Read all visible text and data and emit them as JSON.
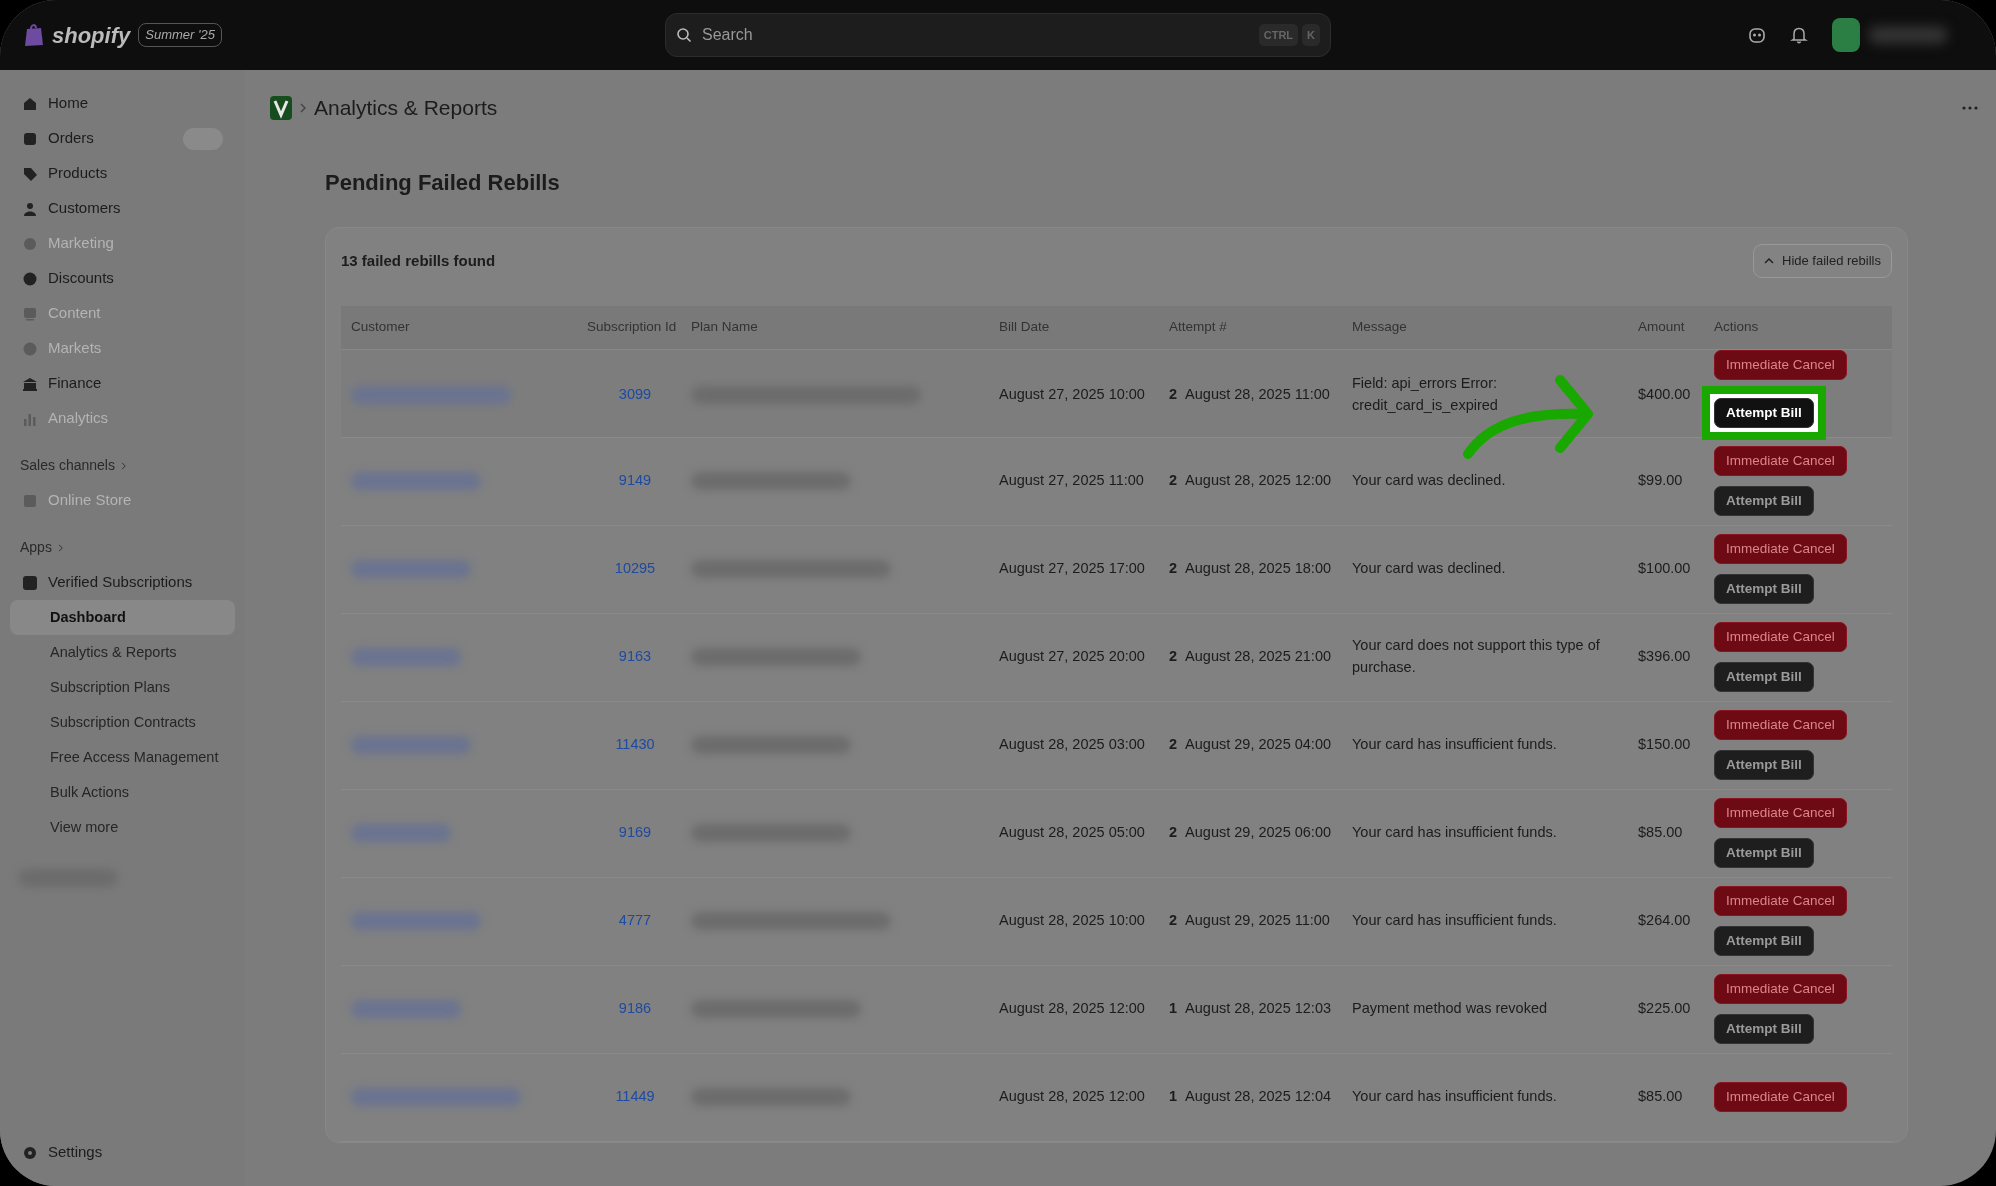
{
  "topbar": {
    "logo": "shopify",
    "edition": "Summer '25",
    "search": {
      "placeholder": "Search"
    },
    "shortcut": [
      "CTRL",
      "K"
    ]
  },
  "sidebar": {
    "items": [
      {
        "label": "Home",
        "disabled": false
      },
      {
        "label": "Orders",
        "disabled": false
      },
      {
        "label": "Products",
        "disabled": false
      },
      {
        "label": "Customers",
        "disabled": false
      },
      {
        "label": "Marketing",
        "disabled": true
      },
      {
        "label": "Discounts",
        "disabled": false
      },
      {
        "label": "Content",
        "disabled": true
      },
      {
        "label": "Markets",
        "disabled": true
      },
      {
        "label": "Finance",
        "disabled": false
      },
      {
        "label": "Analytics",
        "disabled": true
      }
    ],
    "sales_channels": {
      "heading": "Sales channels",
      "items": [
        {
          "label": "Online Store",
          "disabled": true
        }
      ]
    },
    "apps": {
      "heading": "Apps",
      "app": "Verified Subscriptions",
      "items": [
        {
          "label": "Dashboard",
          "selected": true
        },
        {
          "label": "Analytics & Reports",
          "selected": false
        },
        {
          "label": "Subscription Plans",
          "selected": false
        },
        {
          "label": "Subscription Contracts",
          "selected": false
        },
        {
          "label": "Free Access Management",
          "selected": false
        },
        {
          "label": "Bulk Actions",
          "selected": false
        },
        {
          "label": "View more",
          "selected": false
        }
      ]
    },
    "settings": "Settings"
  },
  "breadcrumb": {
    "title": "Analytics & Reports"
  },
  "page": {
    "title": "Pending Failed Rebills",
    "summary": "13 failed rebills found",
    "toggle": "Hide failed rebills"
  },
  "table": {
    "columns": [
      "Customer",
      "Subscription Id",
      "Plan Name",
      "Bill Date",
      "Attempt #",
      "Message",
      "Amount",
      "Actions"
    ],
    "rows": [
      {
        "subscription_id": "3099",
        "bill_date": "August 27, 2025 10:00",
        "attempt": "2",
        "attempt_date": "August 28, 2025 11:00",
        "message": "Field: api_errors Error: credit_card_is_expired",
        "amount": "$400.00",
        "actions": [
          {
            "label": "Immediate Cancel",
            "kind": "danger",
            "highlighted": false
          },
          {
            "label": "Attempt Bill",
            "kind": "dark",
            "highlighted": true
          }
        ]
      },
      {
        "subscription_id": "9149",
        "bill_date": "August 27, 2025 11:00",
        "attempt": "2",
        "attempt_date": "August 28, 2025 12:00",
        "message": "Your card was declined.",
        "amount": "$99.00",
        "actions": [
          {
            "label": "Immediate Cancel",
            "kind": "danger",
            "highlighted": false
          },
          {
            "label": "Attempt Bill",
            "kind": "dark",
            "highlighted": false
          }
        ]
      },
      {
        "subscription_id": "10295",
        "bill_date": "August 27, 2025 17:00",
        "attempt": "2",
        "attempt_date": "August 28, 2025 18:00",
        "message": "Your card was declined.",
        "amount": "$100.00",
        "actions": [
          {
            "label": "Immediate Cancel",
            "kind": "danger",
            "highlighted": false
          },
          {
            "label": "Attempt Bill",
            "kind": "dark",
            "highlighted": false
          }
        ]
      },
      {
        "subscription_id": "9163",
        "bill_date": "August 27, 2025 20:00",
        "attempt": "2",
        "attempt_date": "August 28, 2025 21:00",
        "message": "Your card does not support this type of purchase.",
        "amount": "$396.00",
        "actions": [
          {
            "label": "Immediate Cancel",
            "kind": "danger",
            "highlighted": false
          },
          {
            "label": "Attempt Bill",
            "kind": "dark",
            "highlighted": false
          }
        ]
      },
      {
        "subscription_id": "11430",
        "bill_date": "August 28, 2025 03:00",
        "attempt": "2",
        "attempt_date": "August 29, 2025 04:00",
        "message": "Your card has insufficient funds.",
        "amount": "$150.00",
        "actions": [
          {
            "label": "Immediate Cancel",
            "kind": "danger",
            "highlighted": false
          },
          {
            "label": "Attempt Bill",
            "kind": "dark",
            "highlighted": false
          }
        ]
      },
      {
        "subscription_id": "9169",
        "bill_date": "August 28, 2025 05:00",
        "attempt": "2",
        "attempt_date": "August 29, 2025 06:00",
        "message": "Your card has insufficient funds.",
        "amount": "$85.00",
        "actions": [
          {
            "label": "Immediate Cancel",
            "kind": "danger",
            "highlighted": false
          },
          {
            "label": "Attempt Bill",
            "kind": "dark",
            "highlighted": false
          }
        ]
      },
      {
        "subscription_id": "4777",
        "bill_date": "August 28, 2025 10:00",
        "attempt": "2",
        "attempt_date": "August 29, 2025 11:00",
        "message": "Your card has insufficient funds.",
        "amount": "$264.00",
        "actions": [
          {
            "label": "Immediate Cancel",
            "kind": "danger",
            "highlighted": false
          },
          {
            "label": "Attempt Bill",
            "kind": "dark",
            "highlighted": false
          }
        ]
      },
      {
        "subscription_id": "9186",
        "bill_date": "August 28, 2025 12:00",
        "attempt": "1",
        "attempt_date": "August 28, 2025 12:03",
        "message": "Payment method was revoked",
        "amount": "$225.00",
        "actions": [
          {
            "label": "Immediate Cancel",
            "kind": "danger",
            "highlighted": false
          },
          {
            "label": "Attempt Bill",
            "kind": "dark",
            "highlighted": false
          }
        ]
      },
      {
        "subscription_id": "11449",
        "bill_date": "August 28, 2025 12:00",
        "attempt": "1",
        "attempt_date": "August 28, 2025 12:04",
        "message": "Your card has insufficient funds.",
        "amount": "$85.00",
        "actions": [
          {
            "label": "Immediate Cancel",
            "kind": "danger",
            "highlighted": false
          }
        ]
      }
    ]
  }
}
